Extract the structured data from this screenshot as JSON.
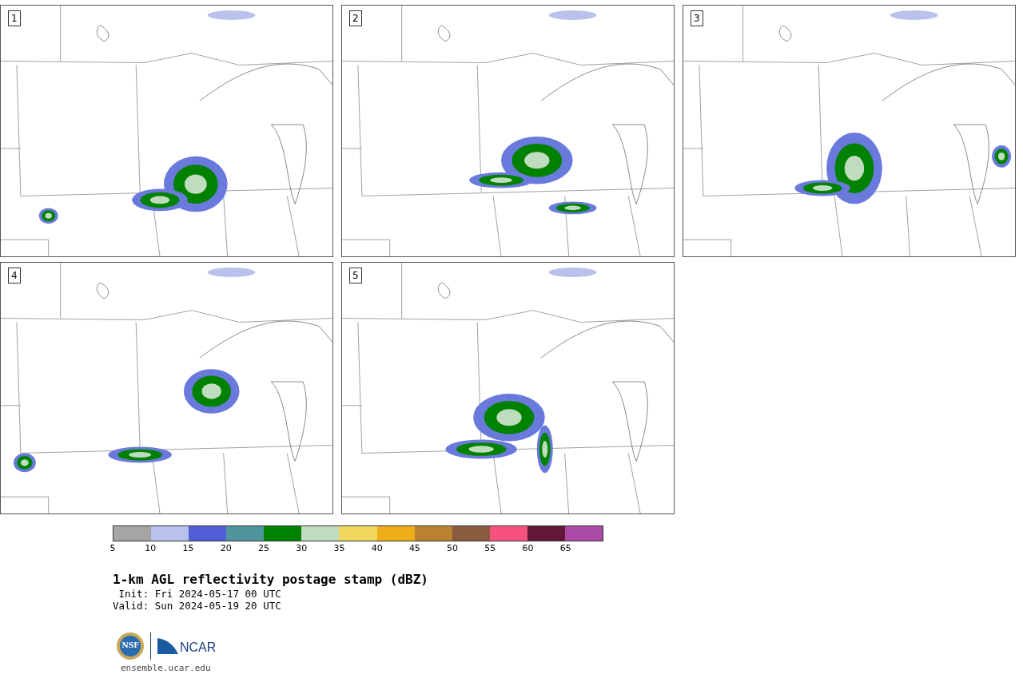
{
  "panels": [
    {
      "label": "1"
    },
    {
      "label": "2"
    },
    {
      "label": "3"
    },
    {
      "label": "4"
    },
    {
      "label": "5"
    }
  ],
  "colorbar": {
    "segments": [
      {
        "color": "#a5a5a5",
        "tick": "5"
      },
      {
        "color": "#b8c2ec",
        "tick": "10"
      },
      {
        "color": "#525ed6",
        "tick": "15"
      },
      {
        "color": "#4e959d",
        "tick": "20"
      },
      {
        "color": "#008200",
        "tick": "25"
      },
      {
        "color": "#bfdcbe",
        "tick": "30"
      },
      {
        "color": "#f0d85c",
        "tick": "35"
      },
      {
        "color": "#eeae17",
        "tick": "40"
      },
      {
        "color": "#b98230",
        "tick": "45"
      },
      {
        "color": "#8a5b3f",
        "tick": "50"
      },
      {
        "color": "#f6527d",
        "tick": "55"
      },
      {
        "color": "#631635",
        "tick": "60"
      },
      {
        "color": "#aa4aa5",
        "tick": "65"
      }
    ]
  },
  "title": "1-km AGL reflectivity postage stamp (dBZ)",
  "init": " Init: Fri 2024-05-17 00 UTC",
  "valid": "Valid: Sun 2024-05-19 20 UTC",
  "logos": {
    "nsf": "NSF",
    "ncar": "NCAR"
  },
  "url": "ensemble.ucar.edu"
}
